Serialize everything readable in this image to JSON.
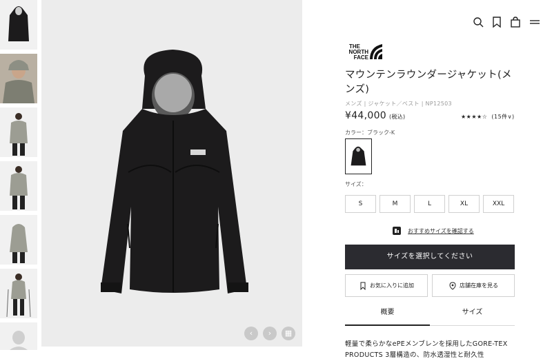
{
  "header": {
    "icons": [
      "search-icon",
      "bookmark-icon",
      "bag-icon",
      "menu-icon"
    ]
  },
  "brand": {
    "logo_lines": [
      "THE",
      "NORTH",
      "FACE"
    ]
  },
  "product": {
    "title": "マウンテンラウンダージャケット(メンズ)",
    "breadcrumb": "メンズ | ジャケット／ベスト | NP12503",
    "price": "¥44,000",
    "tax_note": "(税込)",
    "rating_stars": "★★★★☆",
    "rating_value": 4.5,
    "review_count": "(15件∨)",
    "color_label": "カラー：ブラック-K",
    "size_label": "サイズ：",
    "sizes": [
      "S",
      "M",
      "L",
      "XL",
      "XXL"
    ],
    "recommend_link": "おすすめサイズを確認する",
    "cta_label": "サイズを選択してください",
    "favorite_label": "お気に入りに追加",
    "store_stock_label": "店舗在庫を見る",
    "tabs": [
      "概要",
      "サイズ"
    ],
    "description": "軽量で柔らかなePEメンブレンを採用したGORE-TEX PRODUCTS 3層構造の、防水透湿性と耐久性"
  },
  "gallery": {
    "prev_icon": "chevron-left-icon",
    "next_icon": "chevron-right-icon",
    "grid_icon": "grid-icon"
  },
  "colors": {
    "cta_bg": "#2b2b30",
    "image_bg": "#ececec",
    "jacket": "#1c1b1c"
  }
}
